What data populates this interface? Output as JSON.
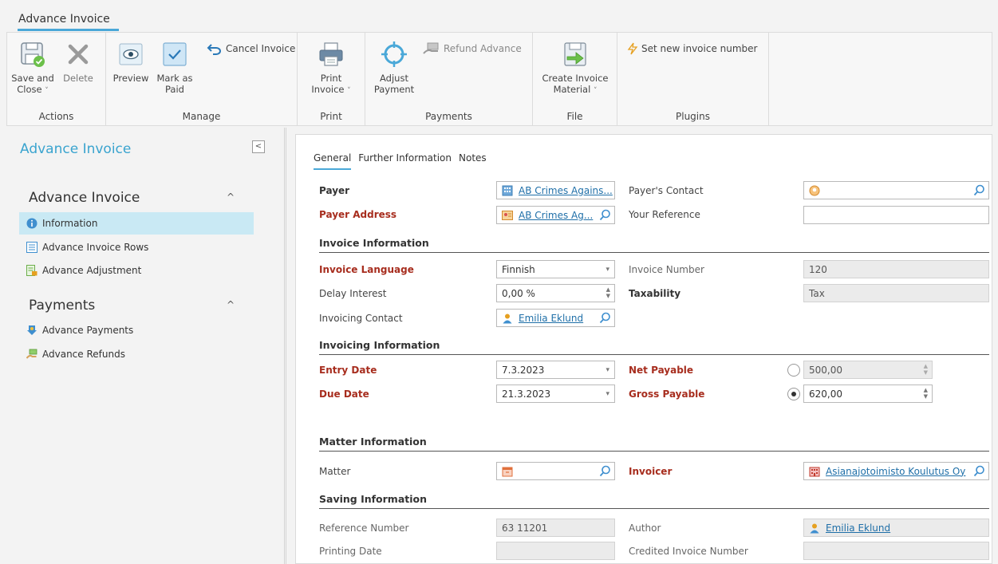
{
  "window": {
    "tab_title": "Advance Invoice"
  },
  "ribbon": {
    "actions": {
      "group_label": "Actions",
      "save_close_line1": "Save and",
      "save_close_line2": "Close",
      "delete_label": "Delete"
    },
    "manage": {
      "group_label": "Manage",
      "preview_label": "Preview",
      "mark_paid_line1": "Mark as",
      "mark_paid_line2": "Paid",
      "cancel_invoice_label": "Cancel Invoice"
    },
    "print": {
      "group_label": "Print",
      "print_line1": "Print",
      "print_line2": "Invoice"
    },
    "payments": {
      "group_label": "Payments",
      "adjust_line1": "Adjust",
      "adjust_line2": "Payment",
      "refund_label": "Refund Advance"
    },
    "file": {
      "group_label": "File",
      "create_line1": "Create Invoice",
      "create_line2": "Material"
    },
    "plugins": {
      "group_label": "Plugins",
      "set_number_label": "Set new invoice number"
    }
  },
  "leftnav": {
    "title": "Advance Invoice",
    "collapse_glyph": "<",
    "section1": {
      "label": "Advance Invoice",
      "items": [
        {
          "label": "Information"
        },
        {
          "label": "Advance Invoice Rows"
        },
        {
          "label": "Advance Adjustment"
        }
      ]
    },
    "section2": {
      "label": "Payments",
      "items": [
        {
          "label": "Advance Payments"
        },
        {
          "label": "Advance Refunds"
        }
      ]
    }
  },
  "tabs": [
    {
      "label": "General"
    },
    {
      "label": "Further Information"
    },
    {
      "label": "Notes"
    }
  ],
  "form": {
    "payer": {
      "label": "Payer",
      "value": "AB Crimes Agains..."
    },
    "payer_contact": {
      "label": "Payer's Contact",
      "value": ""
    },
    "payer_address": {
      "label": "Payer Address",
      "value": "AB Crimes Ag..."
    },
    "your_reference": {
      "label": "Your Reference",
      "value": ""
    },
    "sections": {
      "invoice_info": "Invoice Information",
      "invoicing_info": "Invoicing Information",
      "matter_info": "Matter Information",
      "saving_info": "Saving Information"
    },
    "invoice_language": {
      "label": "Invoice Language",
      "value": "Finnish"
    },
    "invoice_number": {
      "label": "Invoice Number",
      "value": "120"
    },
    "delay_interest": {
      "label": "Delay Interest",
      "value": "0,00 %"
    },
    "taxability": {
      "label": "Taxability",
      "value": "Tax"
    },
    "invoicing_contact": {
      "label": "Invoicing Contact",
      "value": "Emilia Eklund"
    },
    "entry_date": {
      "label": "Entry Date",
      "value": "7.3.2023"
    },
    "net_payable": {
      "label": "Net Payable",
      "value": "500,00"
    },
    "due_date": {
      "label": "Due Date",
      "value": "21.3.2023"
    },
    "gross_payable": {
      "label": "Gross Payable",
      "value": "620,00"
    },
    "matter": {
      "label": "Matter",
      "value": ""
    },
    "invoicer": {
      "label": "Invoicer",
      "value": "Asianajotoimisto Koulutus Oy"
    },
    "reference_number": {
      "label": "Reference Number",
      "value": "63 11201"
    },
    "author": {
      "label": "Author",
      "value": "Emilia Eklund"
    },
    "printing_date": {
      "label": "Printing Date",
      "value": ""
    },
    "credited_invoice_number": {
      "label": "Credited Invoice Number",
      "value": ""
    }
  },
  "colors": {
    "accent": "#4aa8d8",
    "nav_title": "#3aa4cf",
    "required_label": "#a72d1e",
    "active_nav_bg": "#c9e9f4",
    "link": "#1f6fa8"
  }
}
